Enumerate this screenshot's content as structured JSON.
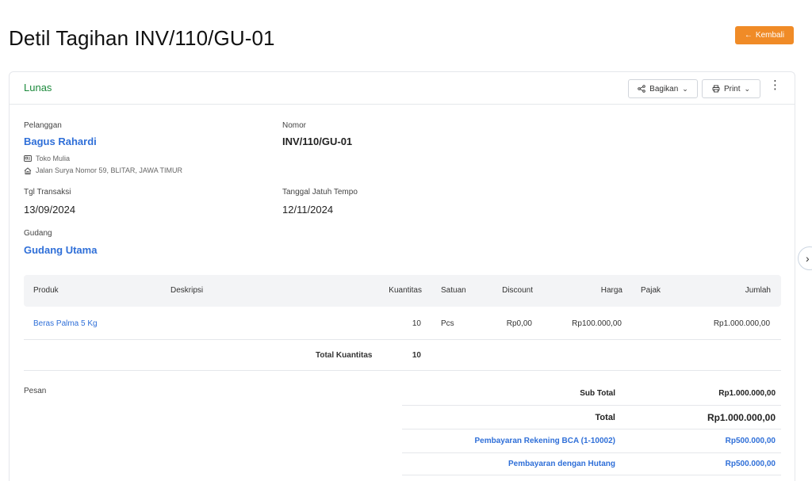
{
  "page": {
    "title": "Detil Tagihan INV/110/GU-01",
    "back_label": "Kembali"
  },
  "header": {
    "status": "Lunas",
    "share_label": "Bagikan",
    "print_label": "Print"
  },
  "details": {
    "customer_label": "Pelanggan",
    "customer_name": "Bagus Rahardi",
    "customer_company": "Toko Mulia",
    "customer_address": "Jalan Surya Nomor 59, BLITAR, JAWA TIMUR",
    "number_label": "Nomor",
    "number_value": "INV/110/GU-01",
    "transaction_date_label": "Tgl Transaksi",
    "transaction_date_value": "13/09/2024",
    "due_date_label": "Tanggal Jatuh Tempo",
    "due_date_value": "12/11/2024",
    "warehouse_label": "Gudang",
    "warehouse_value": "Gudang Utama"
  },
  "table": {
    "columns": {
      "product": "Produk",
      "description": "Deskripsi",
      "quantity": "Kuantitas",
      "unit": "Satuan",
      "discount": "Discount",
      "price": "Harga",
      "tax": "Pajak",
      "amount": "Jumlah"
    },
    "rows": [
      {
        "product": "Beras Palma 5 Kg",
        "description": "",
        "quantity": "10",
        "unit": "Pcs",
        "discount": "Rp0,00",
        "price": "Rp100.000,00",
        "tax": "",
        "amount": "Rp1.000.000,00"
      }
    ],
    "total_quantity_label": "Total Kuantitas",
    "total_quantity_value": "10"
  },
  "summary": {
    "message_label": "Pesan",
    "subtotal_label": "Sub Total",
    "subtotal_value": "Rp1.000.000,00",
    "total_label": "Total",
    "total_value": "Rp1.000.000,00",
    "payments": [
      {
        "label": "Pembayaran Rekening BCA (1-10002)",
        "value": "Rp500.000,00"
      },
      {
        "label": "Pembayaran dengan Hutang",
        "value": "Rp500.000,00"
      }
    ]
  }
}
